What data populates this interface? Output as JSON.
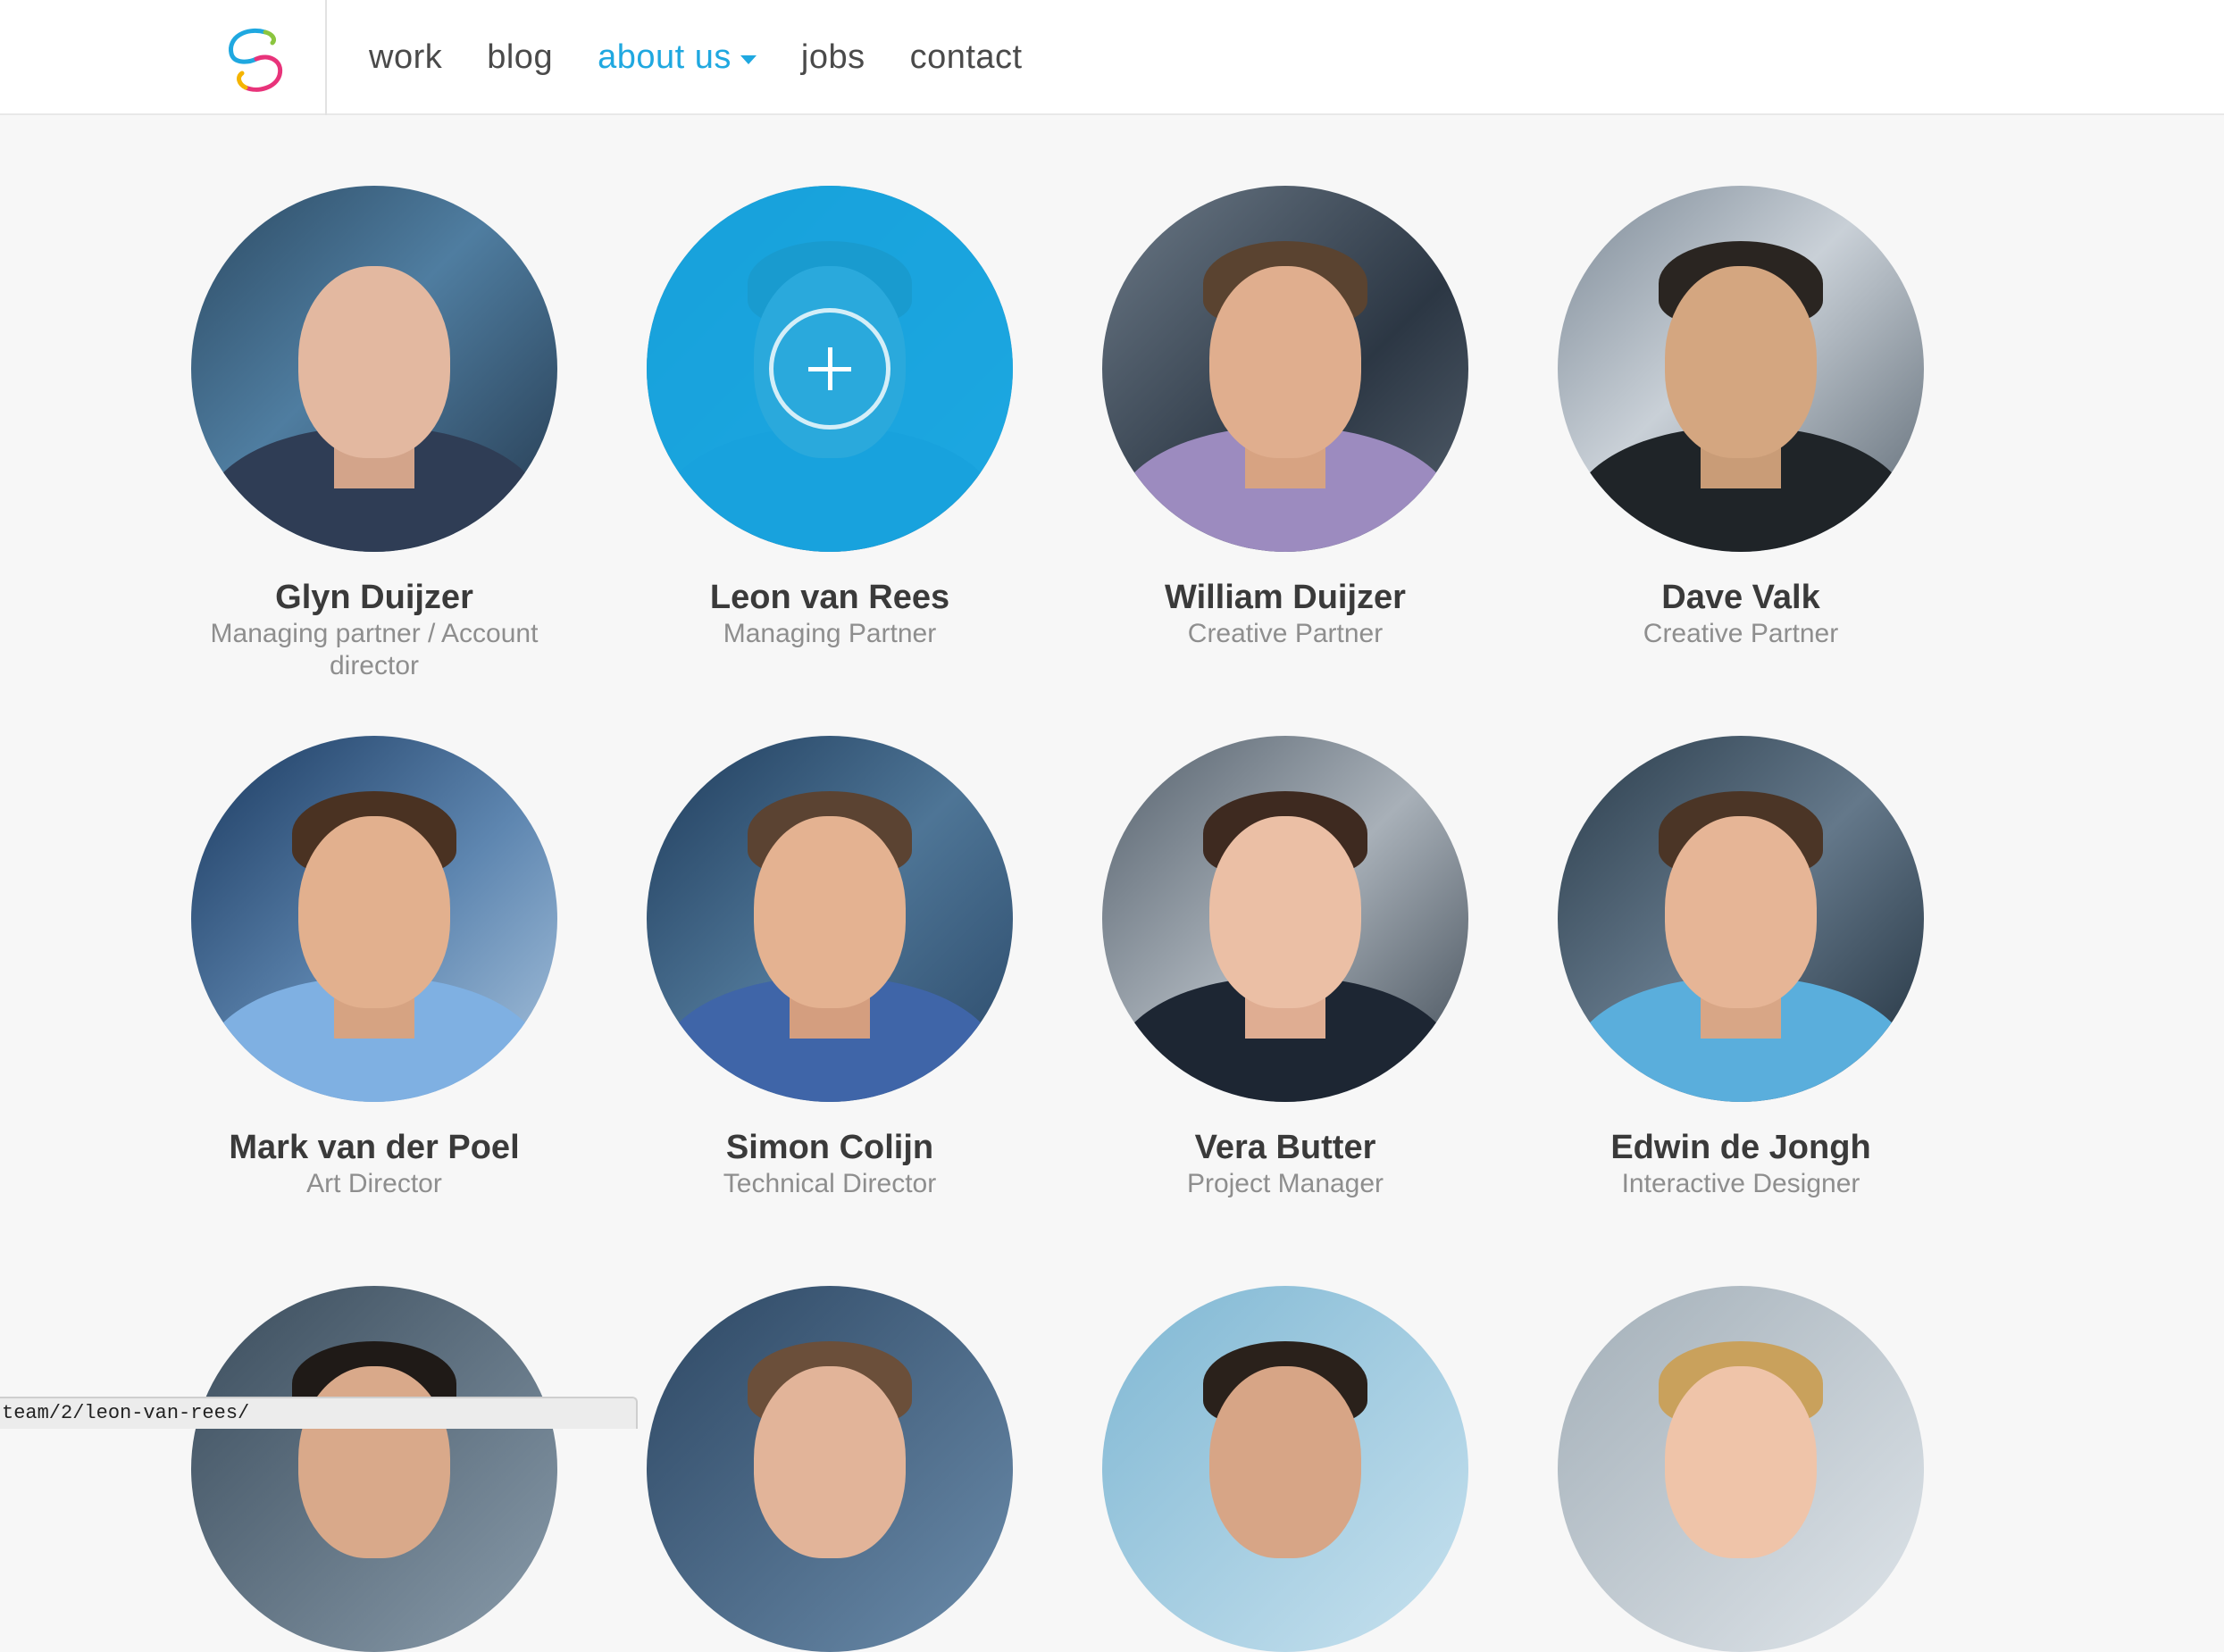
{
  "header": {
    "logo_icon": "swirl-logo-icon",
    "nav": [
      {
        "label": "work",
        "active": false
      },
      {
        "label": "blog",
        "active": false
      },
      {
        "label": "about us",
        "active": true,
        "has_dropdown": true
      },
      {
        "label": "jobs",
        "active": false
      },
      {
        "label": "contact",
        "active": false
      }
    ],
    "accent_color": "#1fa8e0"
  },
  "team": [
    {
      "name": "Glyn Duijzer",
      "role": "Managing partner / Account director"
    },
    {
      "name": "Leon van Rees",
      "role": "Managing Partner",
      "hovered": true
    },
    {
      "name": "William Duijzer",
      "role": "Creative Partner"
    },
    {
      "name": "Dave Valk",
      "role": "Creative Partner"
    },
    {
      "name": "Mark van der Poel",
      "role": "Art Director"
    },
    {
      "name": "Simon Colijn",
      "role": "Technical Director"
    },
    {
      "name": "Vera Butter",
      "role": "Project Manager"
    },
    {
      "name": "Edwin de Jongh",
      "role": "Interactive Designer"
    }
  ],
  "status_bar": {
    "url": "team/2/leon-van-rees/"
  }
}
